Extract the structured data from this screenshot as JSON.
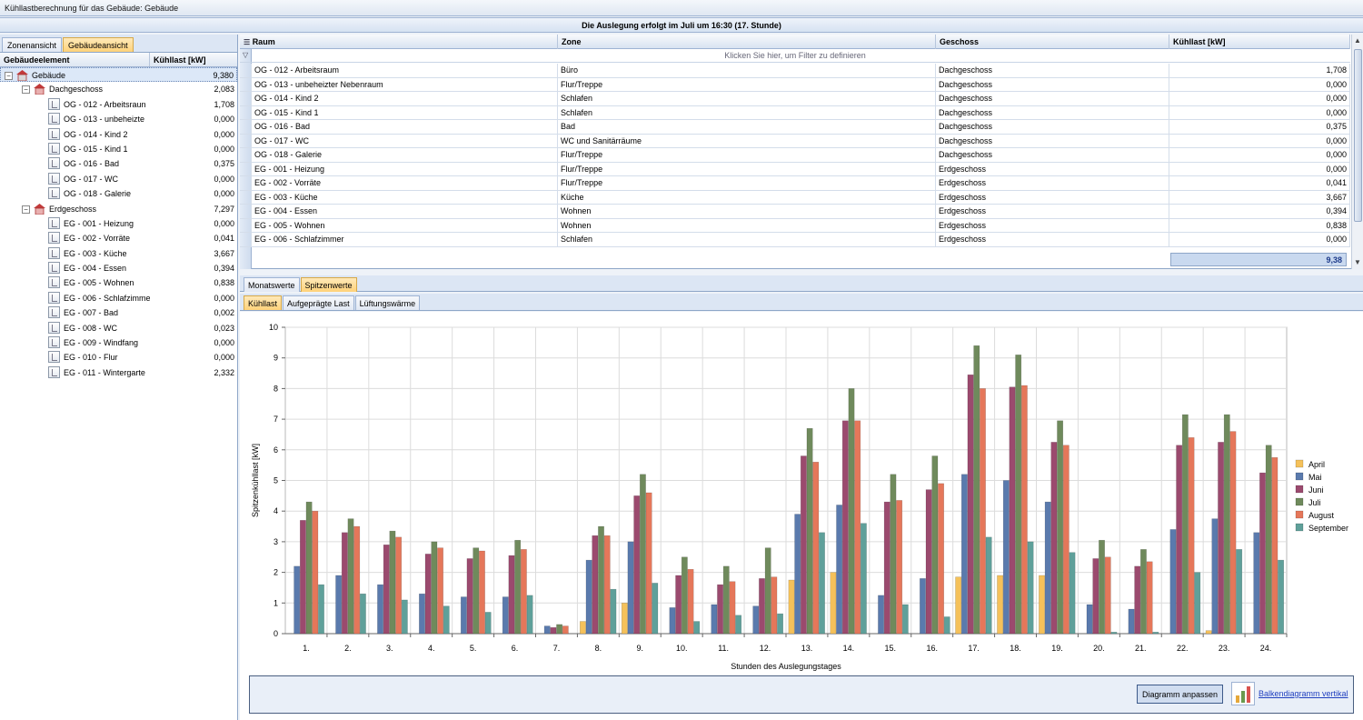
{
  "title": "Kühllastberechnung für das Gebäude: Gebäude",
  "banner": "Die Auslegung erfolgt im Juli um 16:30 (17. Stunde)",
  "left_tabs": [
    "Zonenansicht",
    "Gebäudeansicht"
  ],
  "tree_header": {
    "element": "Gebäudeelement",
    "value": "Kühllast [kW]"
  },
  "tree": [
    {
      "label": "Gebäude",
      "value": "9,380",
      "level": 0,
      "icon": "house-icon",
      "exp": "−"
    },
    {
      "label": "Dachgeschoss",
      "value": "2,083",
      "level": 1,
      "icon": "floor-icon",
      "exp": "−"
    },
    {
      "label": "OG - 012 - Arbeitsraun",
      "value": "1,708",
      "level": 2,
      "icon": "room-icon"
    },
    {
      "label": "OG - 013 - unbeheizte",
      "value": "0,000",
      "level": 2,
      "icon": "room-icon"
    },
    {
      "label": "OG - 014 - Kind 2",
      "value": "0,000",
      "level": 2,
      "icon": "room-icon"
    },
    {
      "label": "OG - 015 - Kind 1",
      "value": "0,000",
      "level": 2,
      "icon": "room-icon"
    },
    {
      "label": "OG - 016 - Bad",
      "value": "0,375",
      "level": 2,
      "icon": "room-icon"
    },
    {
      "label": "OG - 017 - WC",
      "value": "0,000",
      "level": 2,
      "icon": "room-icon"
    },
    {
      "label": "OG - 018 - Galerie",
      "value": "0,000",
      "level": 2,
      "icon": "room-icon"
    },
    {
      "label": "Erdgeschoss",
      "value": "7,297",
      "level": 1,
      "icon": "floor-icon",
      "exp": "−"
    },
    {
      "label": "EG - 001 - Heizung",
      "value": "0,000",
      "level": 2,
      "icon": "room-icon"
    },
    {
      "label": "EG - 002 - Vorräte",
      "value": "0,041",
      "level": 2,
      "icon": "room-icon"
    },
    {
      "label": "EG - 003 - Küche",
      "value": "3,667",
      "level": 2,
      "icon": "room-icon"
    },
    {
      "label": "EG - 004 - Essen",
      "value": "0,394",
      "level": 2,
      "icon": "room-icon"
    },
    {
      "label": "EG - 005 - Wohnen",
      "value": "0,838",
      "level": 2,
      "icon": "room-icon"
    },
    {
      "label": "EG - 006 - Schlafzimme",
      "value": "0,000",
      "level": 2,
      "icon": "room-icon"
    },
    {
      "label": "EG - 007 - Bad",
      "value": "0,002",
      "level": 2,
      "icon": "room-icon"
    },
    {
      "label": "EG - 008 - WC",
      "value": "0,023",
      "level": 2,
      "icon": "room-icon"
    },
    {
      "label": "EG - 009 - Windfang",
      "value": "0,000",
      "level": 2,
      "icon": "room-icon"
    },
    {
      "label": "EG - 010 - Flur",
      "value": "0,000",
      "level": 2,
      "icon": "room-icon"
    },
    {
      "label": "EG - 011 - Wintergarte",
      "value": "2,332",
      "level": 2,
      "icon": "room-icon"
    }
  ],
  "grid": {
    "headers": [
      "Raum",
      "Zone",
      "Geschoss",
      "Kühllast [kW]"
    ],
    "filter_text": "Klicken Sie hier, um Filter zu definieren",
    "rows": [
      [
        "OG - 012 - Arbeitsraum",
        "Büro",
        "Dachgeschoss",
        "1,708"
      ],
      [
        "OG - 013 - unbeheizter Nebenraum",
        "Flur/Treppe",
        "Dachgeschoss",
        "0,000"
      ],
      [
        "OG - 014 - Kind 2",
        "Schlafen",
        "Dachgeschoss",
        "0,000"
      ],
      [
        "OG - 015 - Kind 1",
        "Schlafen",
        "Dachgeschoss",
        "0,000"
      ],
      [
        "OG - 016 - Bad",
        "Bad",
        "Dachgeschoss",
        "0,375"
      ],
      [
        "OG - 017 - WC",
        "WC und Sanitärräume",
        "Dachgeschoss",
        "0,000"
      ],
      [
        "OG - 018 - Galerie",
        "Flur/Treppe",
        "Dachgeschoss",
        "0,000"
      ],
      [
        "EG - 001 - Heizung",
        "Flur/Treppe",
        "Erdgeschoss",
        "0,000"
      ],
      [
        "EG - 002 - Vorräte",
        "Flur/Treppe",
        "Erdgeschoss",
        "0,041"
      ],
      [
        "EG - 003 - Küche",
        "Küche",
        "Erdgeschoss",
        "3,667"
      ],
      [
        "EG - 004 - Essen",
        "Wohnen",
        "Erdgeschoss",
        "0,394"
      ],
      [
        "EG - 005 - Wohnen",
        "Wohnen",
        "Erdgeschoss",
        "0,838"
      ],
      [
        "EG - 006 - Schlafzimmer",
        "Schlafen",
        "Erdgeschoss",
        "0,000"
      ]
    ],
    "sum": "9,38"
  },
  "tabs_level1": [
    "Monatswerte",
    "Spitzenwerte"
  ],
  "tabs_level2": [
    "Kühllast",
    "Aufgeprägte Last",
    "Lüftungswärme"
  ],
  "footer": {
    "button": "Diagramm anpassen",
    "link": "Balkendiagramm vertikal"
  },
  "chart_data": {
    "type": "bar",
    "xlabel": "Stunden des Auslegungstages",
    "ylabel": "Spitzenkühllast [kW]",
    "ylim": [
      0,
      10
    ],
    "yticks": [
      0,
      1,
      2,
      3,
      4,
      5,
      6,
      7,
      8,
      9,
      10
    ],
    "grid": true,
    "legend_position": "right",
    "categories": [
      "1.",
      "2.",
      "3.",
      "4.",
      "5.",
      "6.",
      "7.",
      "8.",
      "9.",
      "10.",
      "11.",
      "12.",
      "13.",
      "14.",
      "15.",
      "16.",
      "17.",
      "18.",
      "19.",
      "20.",
      "21.",
      "22.",
      "23.",
      "24."
    ],
    "series": [
      {
        "name": "April",
        "color": "#f5c15a",
        "values": [
          0,
          0,
          0,
          0,
          0,
          0,
          0,
          0.4,
          1.0,
          0,
          0,
          0,
          1.75,
          2.0,
          0,
          0,
          1.85,
          1.9,
          1.9,
          0,
          0,
          0,
          0.1,
          0
        ]
      },
      {
        "name": "Mai",
        "color": "#5a7aad",
        "values": [
          2.2,
          1.9,
          1.6,
          1.3,
          1.2,
          1.2,
          0.25,
          2.4,
          3.0,
          0.85,
          0.95,
          0.9,
          3.9,
          4.2,
          1.25,
          1.8,
          5.2,
          5.0,
          4.3,
          0.95,
          0.8,
          3.4,
          3.75,
          3.3
        ]
      },
      {
        "name": "Juni",
        "color": "#9b4a6e",
        "values": [
          3.7,
          3.3,
          2.9,
          2.6,
          2.45,
          2.55,
          0.2,
          3.2,
          4.5,
          1.9,
          1.6,
          1.8,
          5.8,
          6.95,
          4.3,
          4.7,
          8.45,
          8.05,
          6.25,
          2.45,
          2.2,
          6.15,
          6.25,
          5.25
        ]
      },
      {
        "name": "Juli",
        "color": "#6f8a5c",
        "values": [
          4.3,
          3.75,
          3.35,
          3.0,
          2.8,
          3.05,
          0.3,
          3.5,
          5.2,
          2.5,
          2.2,
          2.8,
          6.7,
          8.0,
          5.2,
          5.8,
          9.4,
          9.1,
          6.95,
          3.05,
          2.75,
          7.15,
          7.15,
          6.15
        ]
      },
      {
        "name": "August",
        "color": "#e5775a",
        "values": [
          4.0,
          3.5,
          3.15,
          2.8,
          2.7,
          2.75,
          0.25,
          3.2,
          4.6,
          2.1,
          1.7,
          1.85,
          5.6,
          6.95,
          4.35,
          4.9,
          8.0,
          8.1,
          6.15,
          2.5,
          2.35,
          6.4,
          6.6,
          5.75
        ]
      },
      {
        "name": "September",
        "color": "#5fa09a",
        "values": [
          1.6,
          1.3,
          1.1,
          0.9,
          0.7,
          1.25,
          0,
          1.45,
          1.65,
          0.4,
          0.6,
          0.65,
          3.3,
          3.6,
          0.95,
          0.55,
          3.15,
          3.0,
          2.65,
          0.05,
          0.05,
          2.0,
          2.75,
          2.4
        ]
      }
    ]
  }
}
